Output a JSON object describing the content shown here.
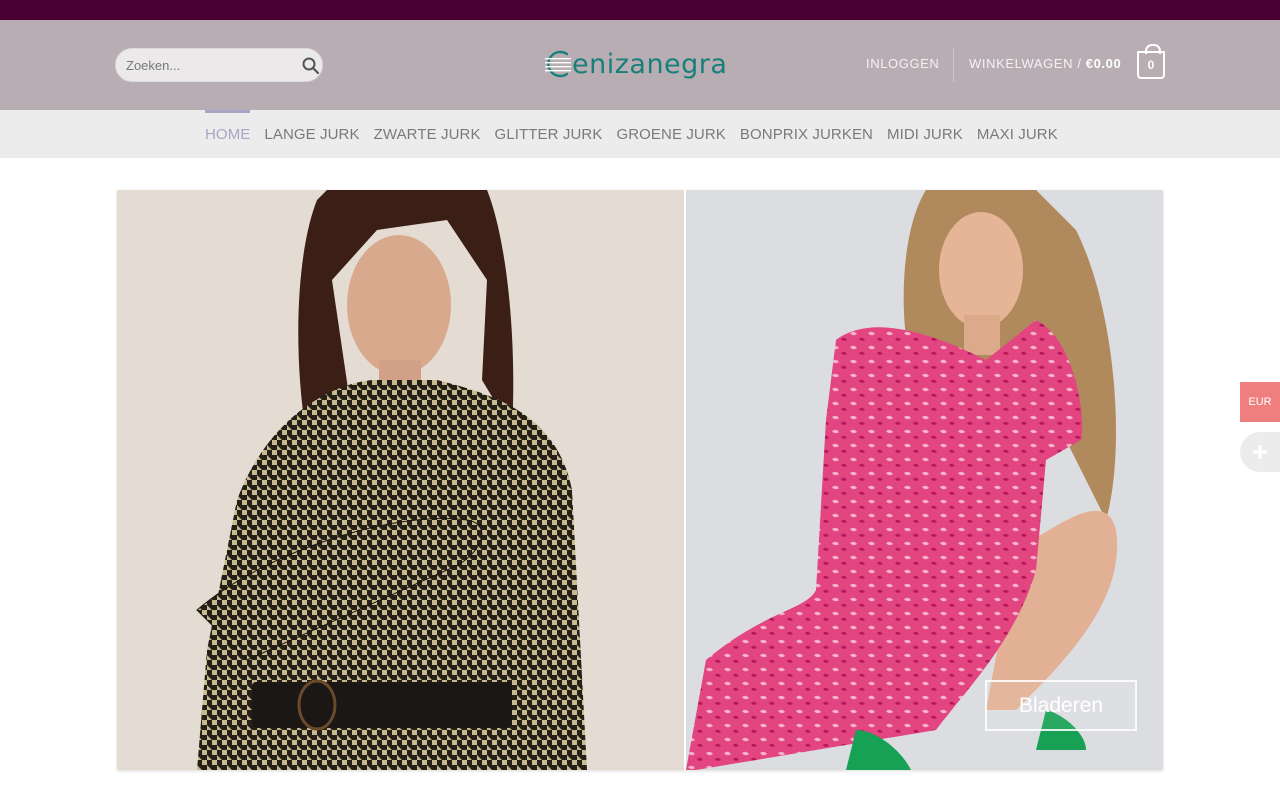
{
  "search": {
    "placeholder": "Zoeken..."
  },
  "logo": {
    "text": "enizanegra"
  },
  "account": {
    "login_label": "INLOGGEN"
  },
  "cart": {
    "label": "WINKELWAGEN / ",
    "amount": "€0.00",
    "count": "0"
  },
  "nav": {
    "items": [
      {
        "label": "HOME",
        "active": true
      },
      {
        "label": "LANGE JURK",
        "active": false
      },
      {
        "label": "ZWARTE JURK",
        "active": false
      },
      {
        "label": "GLITTER JURK",
        "active": false
      },
      {
        "label": "GROENE JURK",
        "active": false
      },
      {
        "label": "BONPRIX JURKEN",
        "active": false
      },
      {
        "label": "MIDI JURK",
        "active": false
      },
      {
        "label": "MAXI JURK",
        "active": false
      }
    ]
  },
  "hero": {
    "browse_label": "Bladeren"
  },
  "currency": {
    "label": "EUR"
  },
  "colors": {
    "top_strip": "#4a0035",
    "header_bg": "#b8adb3",
    "brand": "#17807a",
    "nav_active": "#a9a4c4",
    "currency_bg": "#ef7f7f"
  }
}
